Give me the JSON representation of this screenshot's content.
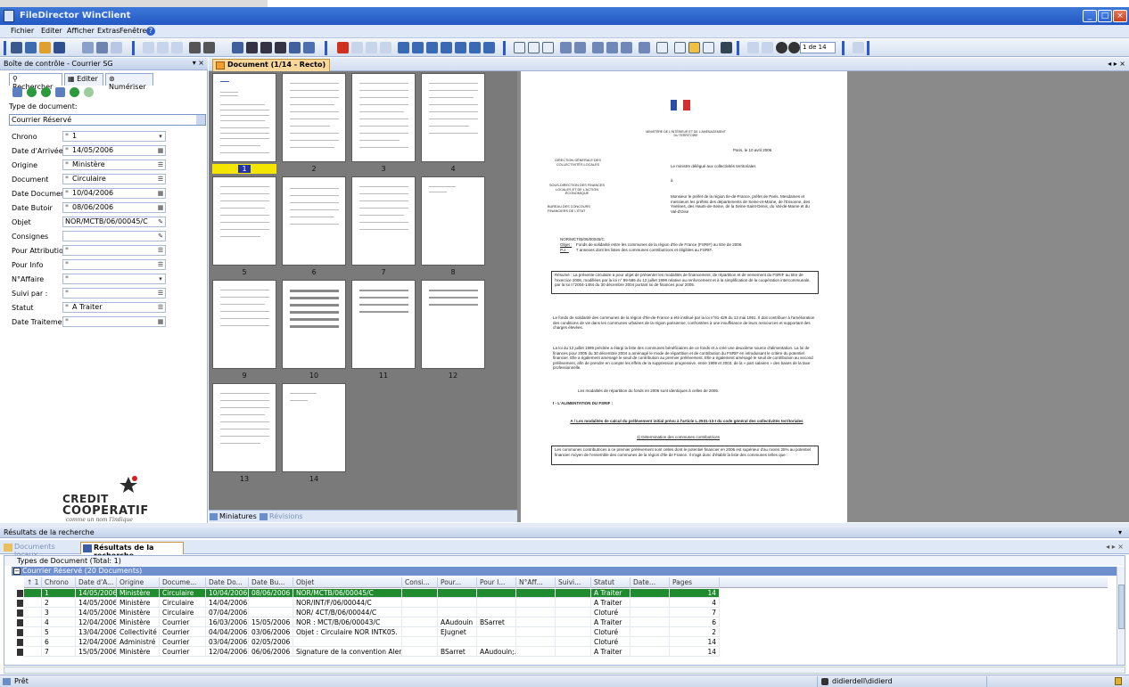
{
  "window": {
    "title": "FileDirector WinClient",
    "controls": [
      "_",
      "□",
      "×"
    ]
  },
  "menu": [
    "Fichier",
    "Editer",
    "Afficher",
    "Extras",
    "Fenêtre"
  ],
  "toolbar": {
    "page_indicator": "1 de 14"
  },
  "control_panel": {
    "title": "Boîte de contrôle - Courrier SG",
    "controls": "▾ ×",
    "tabs": [
      "Rechercher",
      "Editer",
      "Numériser"
    ],
    "doc_type_label": "Type de document:",
    "doc_type_value": "Courrier Réservé",
    "fields": [
      {
        "label": "Chrono",
        "value": "1"
      },
      {
        "label": "Date d'Arrivée",
        "value": "14/05/2006"
      },
      {
        "label": "Origine",
        "value": "Ministère"
      },
      {
        "label": "Document",
        "value": "Circulaire"
      },
      {
        "label": "Date Document",
        "value": "10/04/2006"
      },
      {
        "label": "Date Butoir",
        "value": "08/06/2006"
      },
      {
        "label": "Objet",
        "value": "NOR/MCTB/06/00045/C"
      },
      {
        "label": "Consignes",
        "value": ""
      },
      {
        "label": "Pour Attribution",
        "value": ""
      },
      {
        "label": "Pour Info",
        "value": ""
      },
      {
        "label": "N°Affaire",
        "value": ""
      },
      {
        "label": "Suivi par :",
        "value": ""
      },
      {
        "label": "Statut",
        "value": "A Traiter"
      },
      {
        "label": "Date Traitement",
        "value": ""
      }
    ],
    "logo": {
      "line1": "CREDIT",
      "line2": "COOPERATIF",
      "tagline": "comme un nom l'indique"
    }
  },
  "document": {
    "tab_label": "Document (1/14 - Recto)",
    "tab_controls": "◂ ▸ ×",
    "thumbnail_tabs": [
      "Miniatures",
      "Révisions"
    ],
    "thumbnails": [
      "1",
      "2",
      "3",
      "4",
      "5",
      "6",
      "7",
      "8",
      "9",
      "10",
      "11",
      "12",
      "13",
      "14"
    ],
    "selected_thumbnail": "1",
    "page": {
      "ministry": "MINISTÈRE DE L'INTÉRIEUR ET DE L'AMÉNAGEMENT DU TERRITOIRE",
      "date": "Paris, le 10 avril 2006",
      "sender": "Le ministre délégué aux collectivités territoriales",
      "to": "à",
      "dir1": "DIRECTION GÉNÉRALE DES COLLECTIVITÉS LOCALES",
      "dir2": "SOUS-DIRECTION DES FINANCES LOCALES ET DE L'ACTION ÉCONOMIQUE",
      "dir3": "BUREAU DES CONCOURS FINANCIERS DE L'ÉTAT",
      "recipients": "Monsieur le préfet de la région Ile-de-France, préfet de Paris. Mesdames et messieurs les préfets des départements de Seine-et-Marne, de l'Essonne, des Yvelines, des Hauts-de-Seine, de la Seine-Saint-Denis, du Val-de-Marne et du Val-d'Oise",
      "ref": "NOR/MCT/B/06/00045/C",
      "objet_label": "Objet :",
      "objet": "Fonds de solidarité entre les communes de la région d'Ile de France (FSRIF) au titre de 2006.",
      "pj_label": "P.J. :",
      "pj": "7 annexes dont les listes des communes contributrices et éligibles au FSRIF.",
      "resume": "Résumé : La présente circulaire a pour objet de présenter les modalités de financement, de répartition et de versement du FSRIF au titre de l'exercice 2006, modifiées par la loi n° 99-586 du 12 juillet 1999 relative au renforcement et à la simplification de la coopération intercommunale, par la loi n°2004-1484 du 30 décembre 2004 portant loi de finances pour 2005.",
      "p1": "Le fonds de solidarité des communes de la région d'Ile-de-France a été institué par la loi n°91-429 du 13 mai 1991. Il doit contribuer à l'amélioration des conditions de vie dans les communes urbaines de la région parisienne, confrontées à une insuffisance de leurs ressources et supportant des charges élevées.",
      "p2": "La loi du 12 juillet 1999 précitée a élargi la liste des communes bénéficiaires de ce fonds et a créé une deuxième source d'alimentation. La loi de finances pour 2005 du 30 décembre 2004 a aménagé le mode de répartition et de contribution du FSRIF en introduisant le critère du potentiel financier. Elle a également aménagé le seuil de contribution au premier prélèvement. Elle a également aménagé le seuil de contribution au second prélèvement, afin de prendre en compte les effets de la suppression progressive, entre 1999 et 2003, de la « part salaires » des bases de la taxe professionnelle.",
      "p3": "Les modalités de répartition du fonds en 2006 sont identiques à celles de 2005.",
      "h1": "I - L'ALIMENTATION DU FSRIF :",
      "h2": "A / Les modalités de calcul du prélèvement initial prévu à l'article L.2531-13-I du code général des collectivités territoriales",
      "h3": "1) Détermination des communes contributrices",
      "p4": "Les communes contributrices à ce premier prélèvement sont celles dont le potentiel financier en 2006 est supérieur d'au moins 25% au potentiel financier moyen de l'ensemble des communes de la région d'Ile de France. Il s'agit donc d'établir la liste des communes telles que :"
    }
  },
  "results": {
    "panel_title": "Résultats de la recherche",
    "panel_control": "▾",
    "tabs": [
      "Documents locaux",
      "Résultats de la recherche"
    ],
    "tab_controls": "◂ ▸ ×",
    "types_line": "Types de Document (Total: 1)",
    "group_line": "Courrier Réservé (20 Documents)",
    "columns": [
      "↑ 1",
      "Chrono",
      "Date d'A...",
      "Origine",
      "Docume...",
      "Date Do...",
      "Date Bu...",
      "Objet",
      "Consi...",
      "Pour...",
      "Pour I...",
      "N°Aff...",
      "Suivi...",
      "Statut",
      "Date...",
      "Pages"
    ],
    "rows": [
      [
        "1",
        "14/05/2006",
        "Ministère",
        "Circulaire",
        "10/04/2006",
        "08/06/2006",
        "NOR/MCTB/06/00045/C",
        "",
        "",
        "",
        "",
        "",
        "A Traiter",
        "",
        "14"
      ],
      [
        "2",
        "14/05/2006",
        "Ministère",
        "Circulaire",
        "14/04/2006",
        "",
        "NOR/INT/F/06/00044/C",
        "",
        "",
        "",
        "",
        "",
        "A Traiter",
        "",
        "4"
      ],
      [
        "3",
        "14/05/2006",
        "Ministère",
        "Circulaire",
        "07/04/2006",
        "",
        "NOR/ 4CT/B/06/00044/C",
        "",
        "",
        "",
        "",
        "",
        "Cloturé",
        "",
        "7"
      ],
      [
        "4",
        "12/04/2006",
        "Ministère",
        "Courrier",
        "16/03/2006",
        "15/05/2006",
        "NOR : MCT/B/06/00043/C",
        "",
        "AAudouin",
        "BSarret",
        "",
        "",
        "A Traiter",
        "",
        "6"
      ],
      [
        "5",
        "13/04/2006",
        "Collectivité",
        "Courrier",
        "04/04/2006",
        "03/06/2006",
        "Objet : Circulaire NOR INTK05.",
        "",
        "EJugnet",
        "",
        "",
        "",
        "Cloturé",
        "",
        "2"
      ],
      [
        "6",
        "12/04/2006",
        "Administré",
        "Courrier",
        "03/04/2006",
        "02/05/2006",
        "",
        "",
        "",
        "",
        "",
        "",
        "Cloturé",
        "",
        "14"
      ],
      [
        "7",
        "15/05/2006",
        "Ministère",
        "Courrier",
        "12/04/2006",
        "06/06/2006",
        "Signature de la convention Aler..",
        "",
        "BSarret",
        "AAudouin;..",
        "",
        "",
        "A Traiter",
        "",
        "14"
      ]
    ]
  },
  "status": {
    "ready": "Prêt",
    "user": "didierdell\\didierd"
  }
}
